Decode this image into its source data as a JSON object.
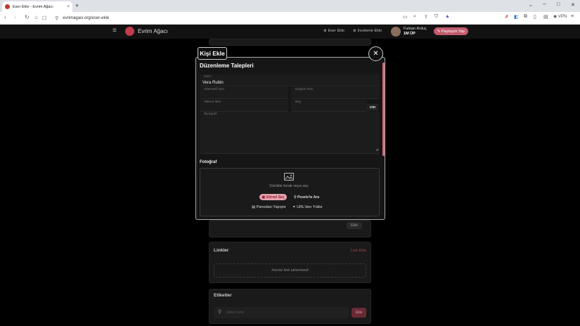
{
  "browser": {
    "tab_title": "Eser Ekle - Evrim Ağacı",
    "tab_close": "×",
    "new_tab": "+",
    "url": "evrimagaci.org/eser-ekle",
    "vpn": "VPN",
    "win_min": "─",
    "win_max": "□",
    "win_close": "✕",
    "chevron": "⌄"
  },
  "site": {
    "brand": "Evrim Ağacı",
    "nav_work": "Eser Ekle",
    "nav_review": "İnceleme Ekle",
    "user_name": "Furkan Arduç",
    "user_up": "1M ÜP",
    "share": "Paylaşım Yap"
  },
  "background": {
    "links_title": "Linkler",
    "links_add": "Link Ekle",
    "links_empty": "Henüz link eklenmedi",
    "tags_title": "Etiketler",
    "tags_placeholder": "Etiket İsmi",
    "tags_add": "Ekle",
    "above_add": "Ekle"
  },
  "modal": {
    "tag": "Kişi Ekle",
    "title": "Düzenleme Talepleri",
    "close": "✕",
    "fields": {
      "name_label": "İsim",
      "name_required": "*",
      "name_value": "Vera Rubin",
      "alt_name_label": "Alternatif İsim",
      "birth_label": "Doğum İsmi",
      "nickname_label": "Takma İsim",
      "height_label": "Boy",
      "height_unit": "cm",
      "bio_label": "Biyografi"
    },
    "photo": {
      "section_label": "Fotoğraf",
      "drop_text": "Sürükle bırak veya seç",
      "pick_button": "Görsel Seç",
      "pexels_button": "Pexels'te Ara",
      "paste_button": "Panodan Yapıştır",
      "url_button": "URL'den Yükle"
    }
  },
  "colors": {
    "accent": "#c23a4d",
    "accent_soft": "#e7a4af"
  }
}
